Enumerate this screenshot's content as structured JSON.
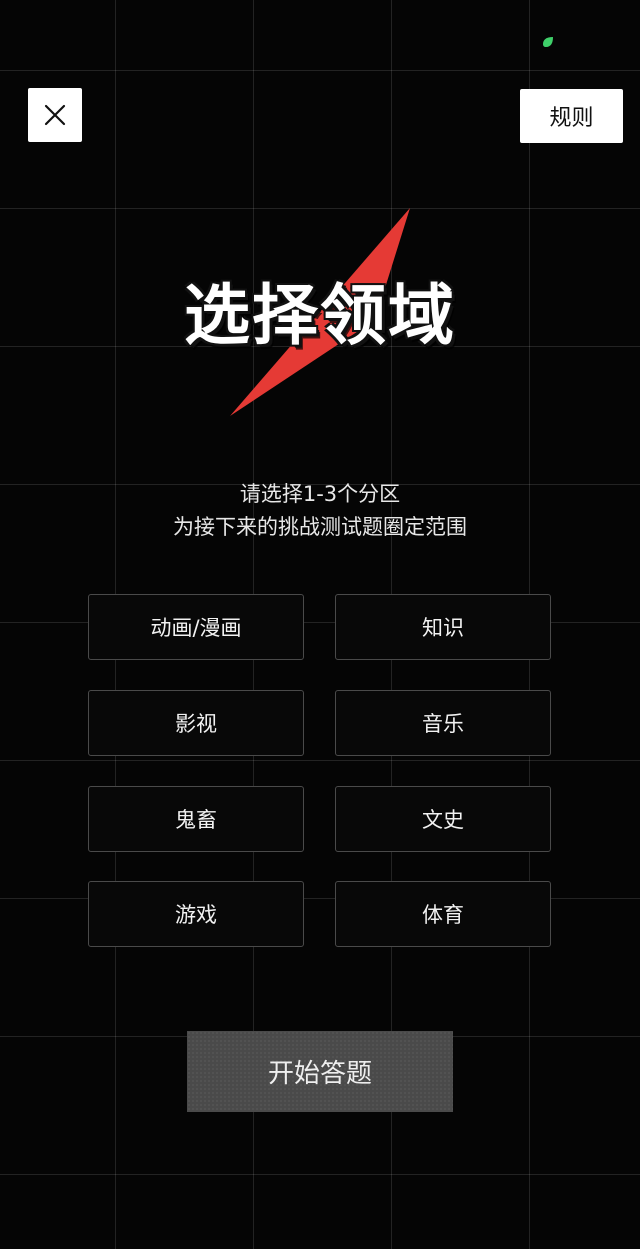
{
  "status_bar": {
    "icon": "leaf-icon",
    "icon_color": "#3fd06a"
  },
  "header": {
    "close_icon": "close-icon",
    "rules_label": "规则"
  },
  "hero": {
    "title": "选择领域",
    "bolt_color": "#e53a35"
  },
  "instructions": {
    "line1": "请选择1-3个分区",
    "line2": "为接下来的挑战测试题圈定范围"
  },
  "categories": [
    {
      "label": "动画/漫画"
    },
    {
      "label": "知识"
    },
    {
      "label": "影视"
    },
    {
      "label": "音乐"
    },
    {
      "label": "鬼畜"
    },
    {
      "label": "文史"
    },
    {
      "label": "游戏"
    },
    {
      "label": "体育"
    }
  ],
  "start_button": {
    "label": "开始答题"
  }
}
